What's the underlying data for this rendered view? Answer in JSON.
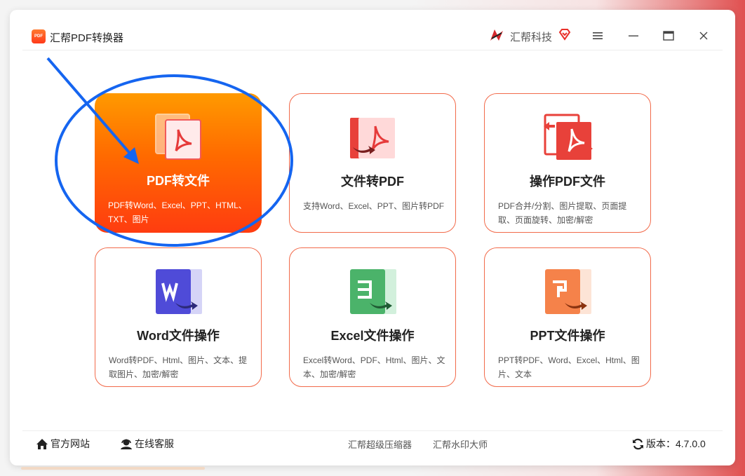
{
  "app": {
    "title": "汇帮PDF转换器",
    "logo_text": "PDF",
    "brand": "汇帮科技"
  },
  "colors": {
    "accent_orange": "#ff6a00",
    "card_border": "#f26a4a",
    "annotation_blue": "#1565f0"
  },
  "cards": [
    {
      "title": "PDF转文件",
      "desc": "PDF转Word、Excel、PPT、HTML、TXT、图片",
      "icon": "pdf-to-file-icon",
      "active": true
    },
    {
      "title": "文件转PDF",
      "desc": "支持Word、Excel、PPT、图片转PDF",
      "icon": "file-to-pdf-icon"
    },
    {
      "title": "操作PDF文件",
      "desc": "PDF合并/分割、图片提取、页面提取、页面旋转、加密/解密",
      "icon": "pdf-operate-icon"
    },
    {
      "title": "Word文件操作",
      "desc": "Word转PDF、Html、图片、文本、提取图片、加密/解密",
      "icon": "word-icon"
    },
    {
      "title": "Excel文件操作",
      "desc": "Excel转Word、PDF、Html、图片、文本、加密/解密",
      "icon": "excel-icon"
    },
    {
      "title": "PPT文件操作",
      "desc": "PPT转PDF、Word、Excel、Html、图片、文本",
      "icon": "ppt-icon"
    }
  ],
  "footer": {
    "website": "官方网站",
    "service": "在线客服",
    "link1": "汇帮超级压缩器",
    "link2": "汇帮水印大师",
    "version_label": "版本：",
    "version": "4.7.0.0"
  }
}
